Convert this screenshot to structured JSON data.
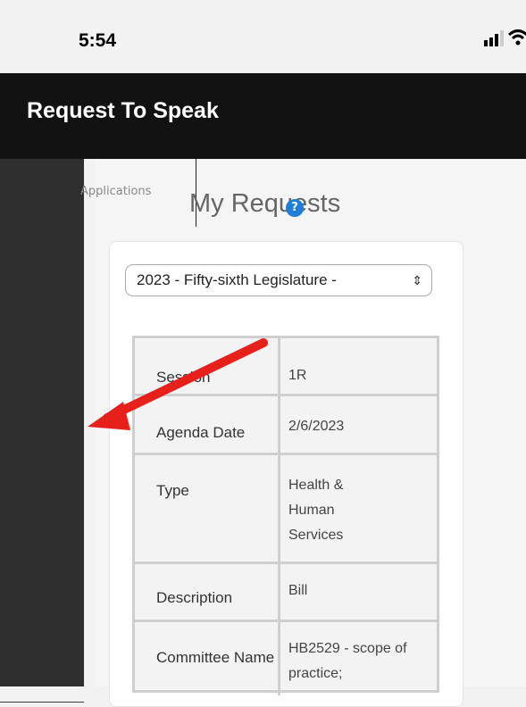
{
  "status_bar": {
    "time": "5:54"
  },
  "app": {
    "title": "Request To Speak"
  },
  "sidebar": {
    "items": [
      {
        "icon": "document-icon"
      },
      {
        "icon": "document-icon",
        "active": true
      },
      {
        "icon": "calendar-icon"
      },
      {
        "icon": "microphone-add-icon"
      },
      {
        "icon": "file-icon"
      },
      {
        "icon": "list-document-icon"
      },
      {
        "icon": "search-icon"
      }
    ],
    "hover_label": "Applications"
  },
  "main": {
    "title": "My Requests",
    "help": "?",
    "session_select": {
      "value": "2023 - Fifty-sixth Legislature -"
    },
    "details": [
      {
        "label": "Session",
        "value": "1R"
      },
      {
        "label": "Agenda Date",
        "value": "2/6/2023"
      },
      {
        "label": "Type",
        "value": "Health & Human Services"
      },
      {
        "label": "Description",
        "value": "Bill"
      },
      {
        "label": "Committee Name",
        "value": "HB2529 - scope of practice;"
      }
    ]
  },
  "colors": {
    "active_indicator": "#8dc63f",
    "arrow": "#e8201c",
    "help": "#1e7fd8"
  }
}
